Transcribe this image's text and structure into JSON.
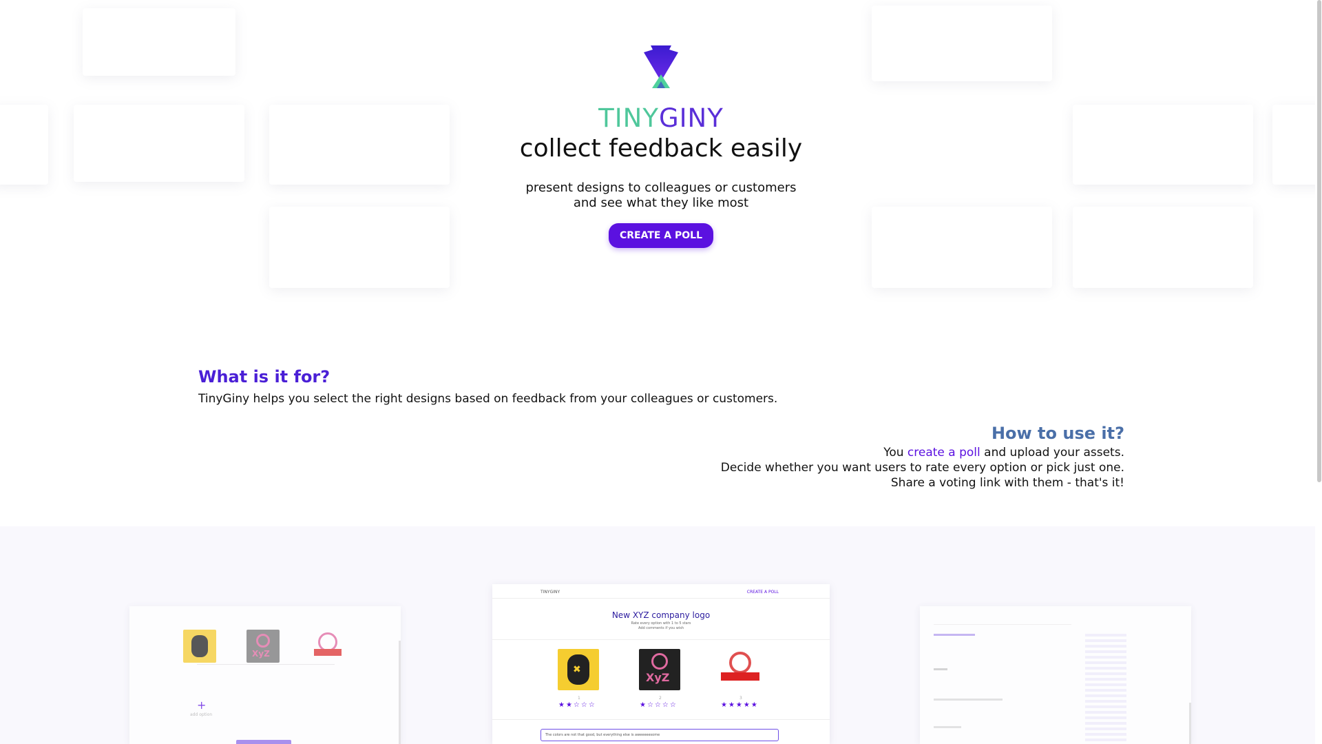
{
  "brand": {
    "tiny": "TINY",
    "giny": "GINY"
  },
  "hero": {
    "headline": "collect feedback easily",
    "sub_line1": "present designs to colleagues or customers",
    "sub_line2": "and see what they like most",
    "cta_label": "CREATE A POLL"
  },
  "what": {
    "heading": "What is it for?",
    "text": "TinyGiny helps you select the right designs based on feedback from your colleagues or customers."
  },
  "how": {
    "heading": "How to use it?",
    "line1_prefix": "You ",
    "line1_link": "create a poll",
    "line1_suffix": " and upload your assets.",
    "line2": "Decide whether you want users to rate every option or pick just one.",
    "line3": "Share a voting link with them - that's it!"
  },
  "shots": {
    "center_brand": "TINYGINY",
    "center_nav": "CREATE A POLL",
    "center_title": "New XYZ company logo",
    "center_sub1": "Rate every option with 1 to 5 stars",
    "center_sub2": "Add comments if you wish",
    "center_comment": "The colors are not that good, but everything else is aweeeeesome",
    "left_add": "+",
    "left_add_label": "add option",
    "option_numbers": [
      "1",
      "2",
      "3"
    ],
    "ratings": [
      2,
      1,
      5
    ]
  },
  "colors": {
    "accent": "#5b11e0",
    "tiny": "#4fc79b",
    "giny": "#5a2fd8",
    "how_heading": "#4a6fa8"
  }
}
